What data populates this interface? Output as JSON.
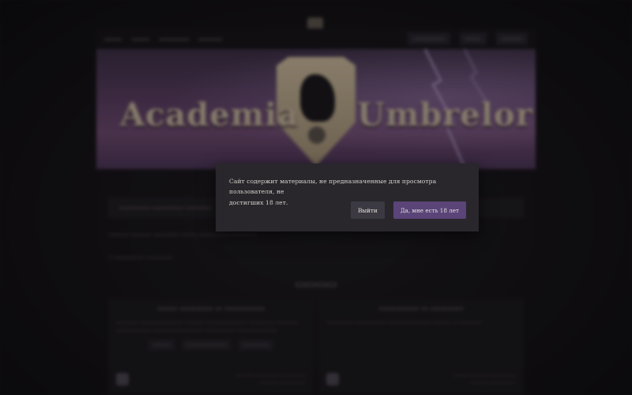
{
  "modal": {
    "message_line1": "Сайт содержит материалы, не предназначенные для просмотра пользователя, не",
    "message_line2": "достигших 18 лет.",
    "exit_label": "Выйти",
    "confirm_label": "Да, мне есть 18 лет"
  },
  "banner": {
    "title_left": "Academia",
    "title_right": "Umbrelor"
  },
  "colors": {
    "modal_bg": "#29272c",
    "exit_button": "#3b3941",
    "confirm_button": "#5a4478",
    "page_bg": "#121114"
  },
  "icons": {
    "emblem": "crest-icon",
    "raven": "raven-icon"
  }
}
